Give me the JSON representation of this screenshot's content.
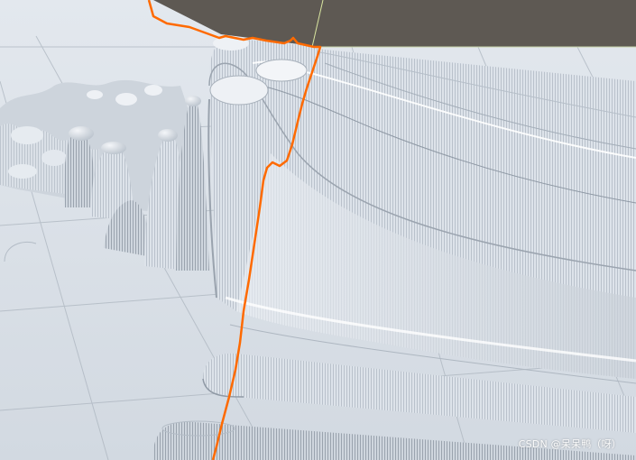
{
  "viewport": {
    "view": "scene-3d",
    "background_color": "#5e5953",
    "terrain_color": "#d6dee7",
    "selection_outline_color": "#ff6a00",
    "grid_visible": true
  },
  "watermark": {
    "text": "CSDN @呆呆鸭（呀）"
  }
}
